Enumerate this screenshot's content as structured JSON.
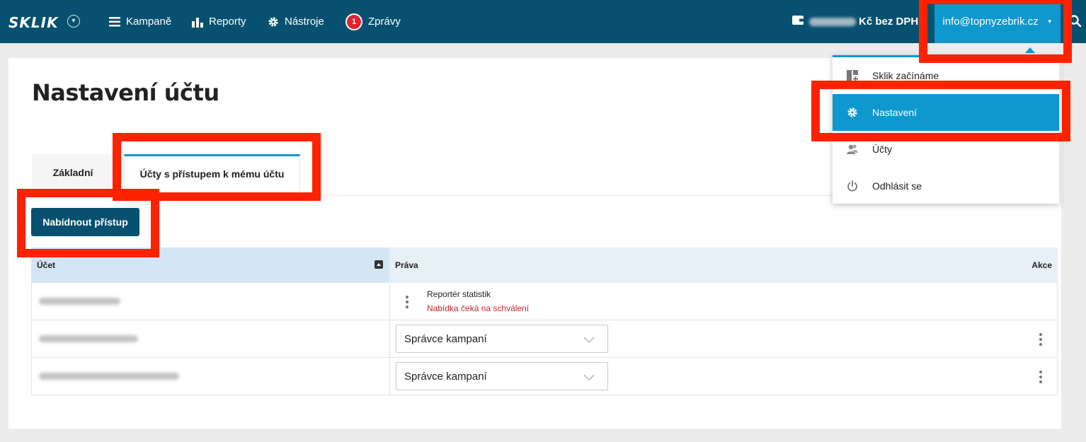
{
  "header": {
    "logo": "SKLIK",
    "nav": [
      {
        "label": "Kampaně",
        "icon": "menu-icon"
      },
      {
        "label": "Reporty",
        "icon": "bar-chart-icon"
      },
      {
        "label": "Nástroje",
        "icon": "gear-icon"
      },
      {
        "label": "Zprávy",
        "icon": "badge",
        "badge": "1"
      }
    ],
    "credit_suffix": "Kč bez DPH",
    "user_email": "info@topnyzebrik.cz"
  },
  "dropdown": {
    "items": [
      {
        "label": "Sklik začínáme",
        "icon": "dashboard-icon"
      },
      {
        "label": "Nastavení",
        "icon": "gear-icon",
        "active": true
      },
      {
        "label": "Účty",
        "icon": "users-icon"
      },
      {
        "label": "Odhlásit se",
        "icon": "power-icon"
      }
    ]
  },
  "page": {
    "title": "Nastavení účtu",
    "tabs": [
      {
        "label": "Základní"
      },
      {
        "label": "Účty s přístupem k mému účtu",
        "active": true
      }
    ],
    "offer_button": "Nabídnout přístup"
  },
  "table": {
    "headers": {
      "account": "Účet",
      "rights": "Práva",
      "actions": "Akce"
    },
    "rows": [
      {
        "rights_label": "Reportér statistik",
        "status": "Nabídka čeká na schválení"
      },
      {
        "select_value": "Správce kampaní"
      },
      {
        "select_value": "Správce kampaní"
      }
    ]
  },
  "colors": {
    "header_bg": "#07506f",
    "accent": "#0f98cd",
    "highlight": "#ff2200",
    "pending": "#c8262e"
  }
}
